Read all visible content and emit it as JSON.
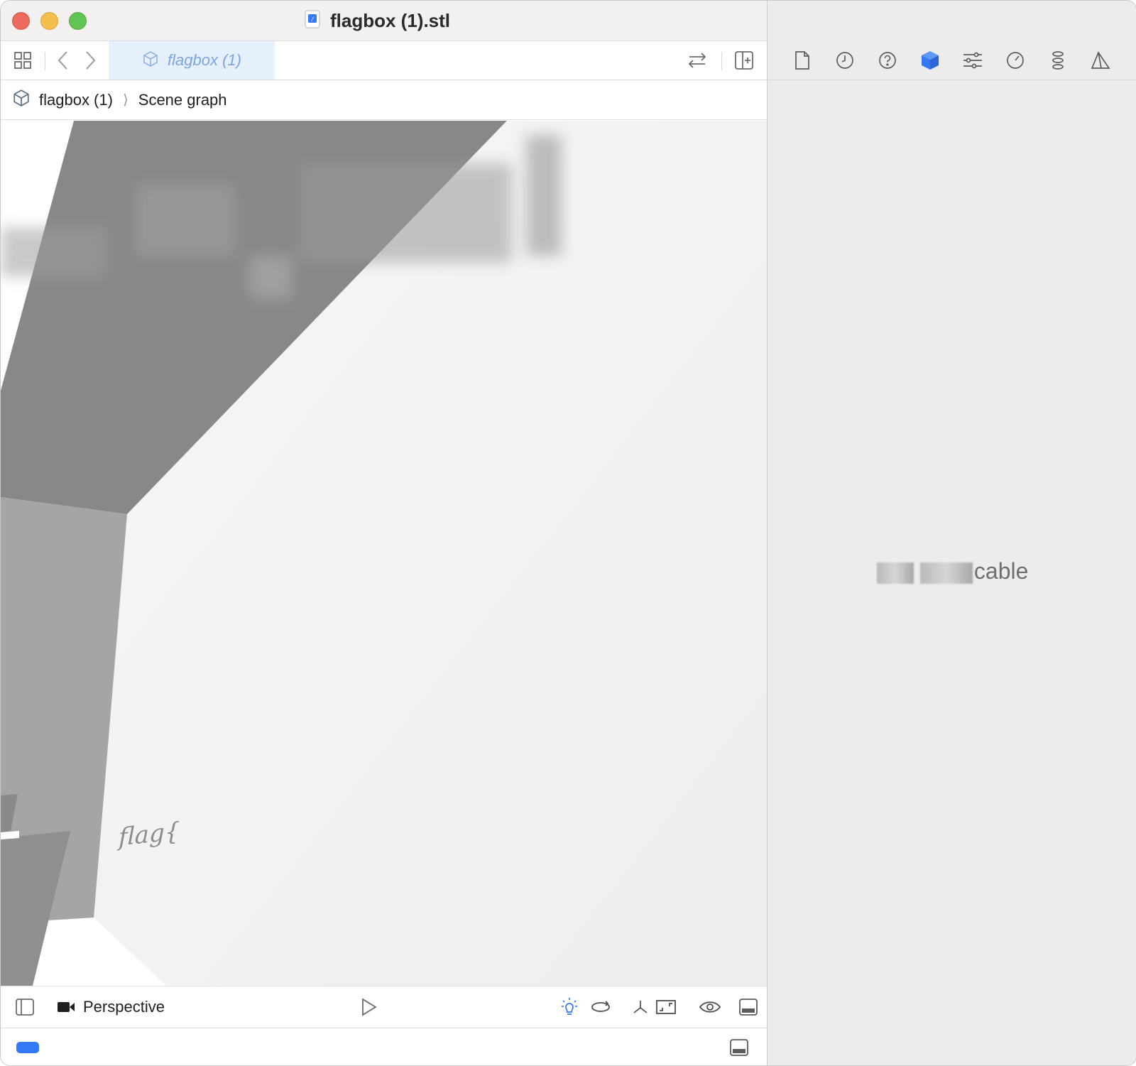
{
  "window": {
    "title": "flagbox (1).stl"
  },
  "toolbar": {
    "tab_label": "flagbox (1)",
    "icons": [
      "grid-icon",
      "back-icon",
      "forward-icon",
      "swap-icon",
      "add-editor-icon"
    ]
  },
  "breadcrumb": {
    "file": "flagbox (1)",
    "section": "Scene graph"
  },
  "viewport": {
    "visible_text": "flag{"
  },
  "scene_bar": {
    "camera_label": "Perspective",
    "icons": [
      "sidebar-toggle-icon",
      "camera-icon",
      "play-icon",
      "light-icon",
      "orbit-icon",
      "axes-icon",
      "frame-icon",
      "eye-icon",
      "panel-toggle-icon"
    ]
  },
  "status_bar": {
    "accent": "#3478f6"
  },
  "inspector": {
    "tabs": [
      "file-inspector-icon",
      "history-icon",
      "help-icon",
      "node-inspector-icon",
      "attributes-icon",
      "timer-icon",
      "physics-icon",
      "material-icon"
    ],
    "selected_tab": "node-inspector-icon",
    "message_visible": "cable"
  },
  "colors": {
    "accent": "#3478f6",
    "tab_highlight": "#e6f0fc"
  }
}
